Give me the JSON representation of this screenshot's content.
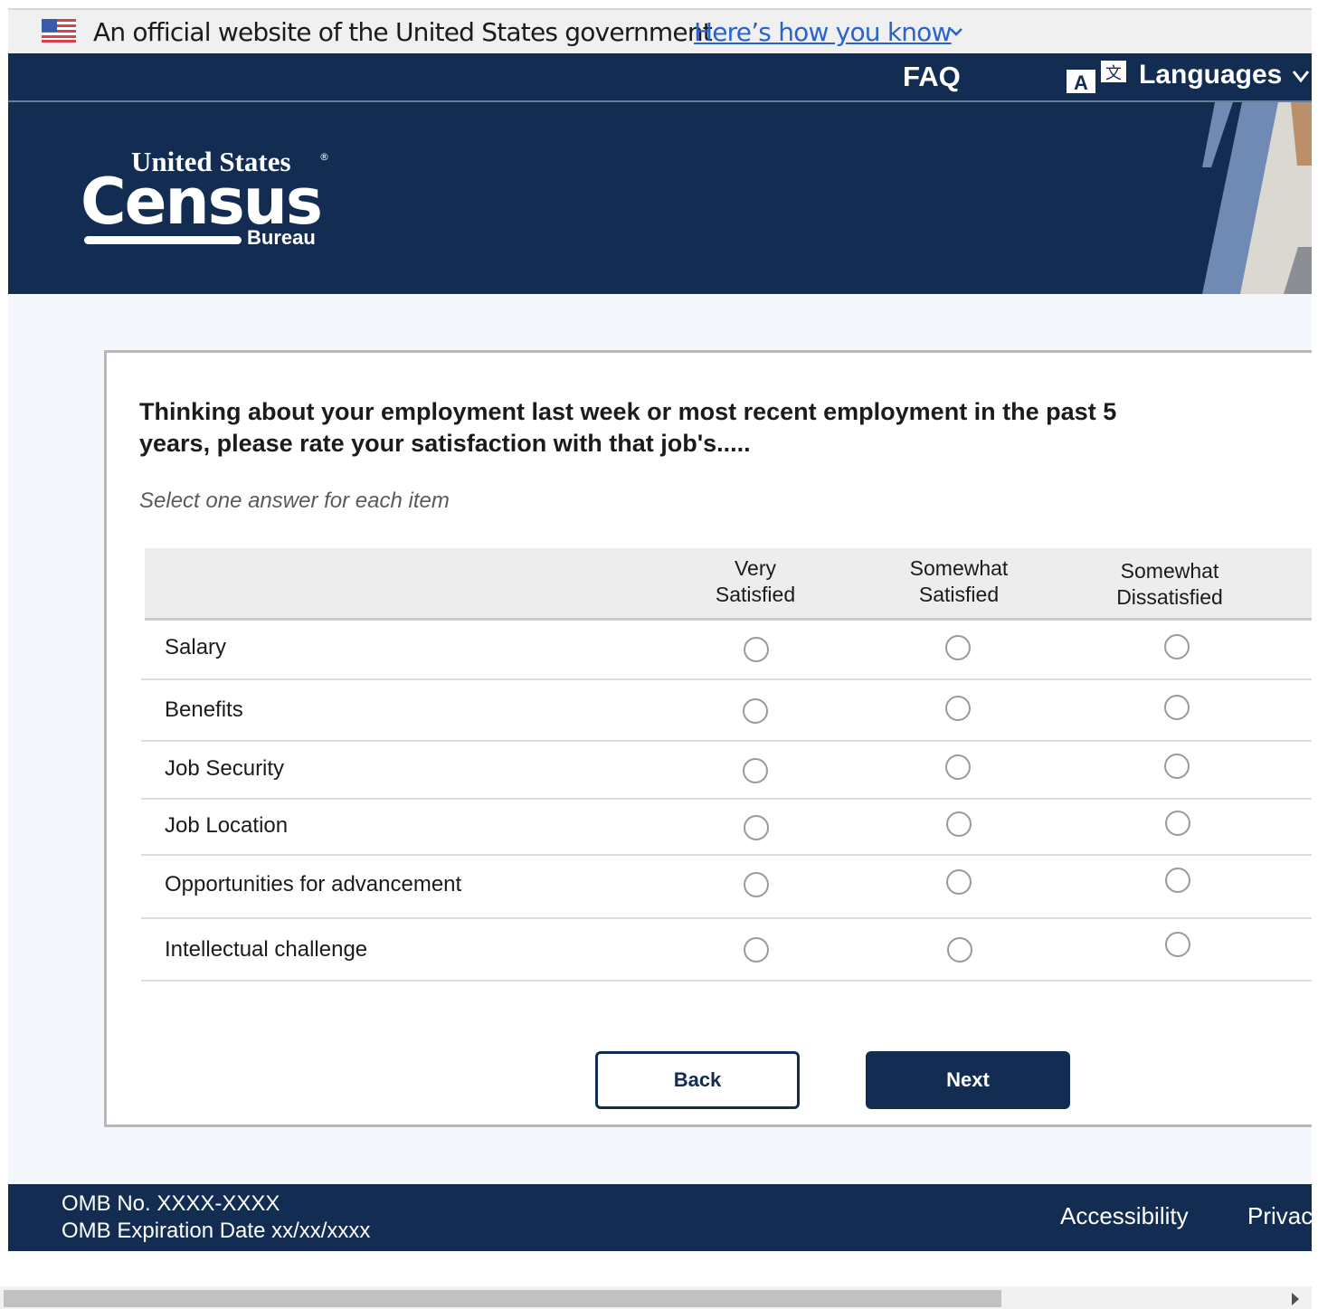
{
  "gov_banner": {
    "text": "An official website of the United States government",
    "link": "Here’s how you know"
  },
  "topnav": {
    "faq": "FAQ",
    "languages": "Languages",
    "languages_icon_letter": "A",
    "languages_icon_glyph": "文"
  },
  "logo": {
    "line1": "United States",
    "line2": "Census",
    "line3": "Bureau",
    "registered": "®"
  },
  "survey": {
    "question": "Thinking about your employment last week or most recent employment in the past 5 years, please rate your satisfaction with that job's.....",
    "instruction": "Select one answer for each item",
    "columns": [
      {
        "line1": "Very",
        "line2": "Satisfied"
      },
      {
        "line1": "Somewhat",
        "line2": "Satisfied"
      },
      {
        "line1": "Somewhat",
        "line2": "Dissatisfied"
      }
    ],
    "rows": [
      {
        "label": "Salary"
      },
      {
        "label": "Benefits"
      },
      {
        "label": "Job Security"
      },
      {
        "label": "Job Location"
      },
      {
        "label": "Opportunities for advancement"
      },
      {
        "label": "Intellectual challenge"
      }
    ],
    "back_label": "Back",
    "next_label": "Next"
  },
  "footer": {
    "omb_number": "OMB No. XXXX-XXXX",
    "omb_expiration": "OMB Expiration Date xx/xx/xxxx",
    "accessibility": "Accessibility",
    "privacy": "Privacy"
  },
  "colors": {
    "navy": "#132c51",
    "link_blue": "#2a63c9",
    "stripe_blue": "#6f8bb3"
  },
  "icons": [
    "us-flag-icon",
    "chevron-down-icon",
    "translate-icon",
    "radio-button",
    "scroll-right-arrow-icon"
  ]
}
